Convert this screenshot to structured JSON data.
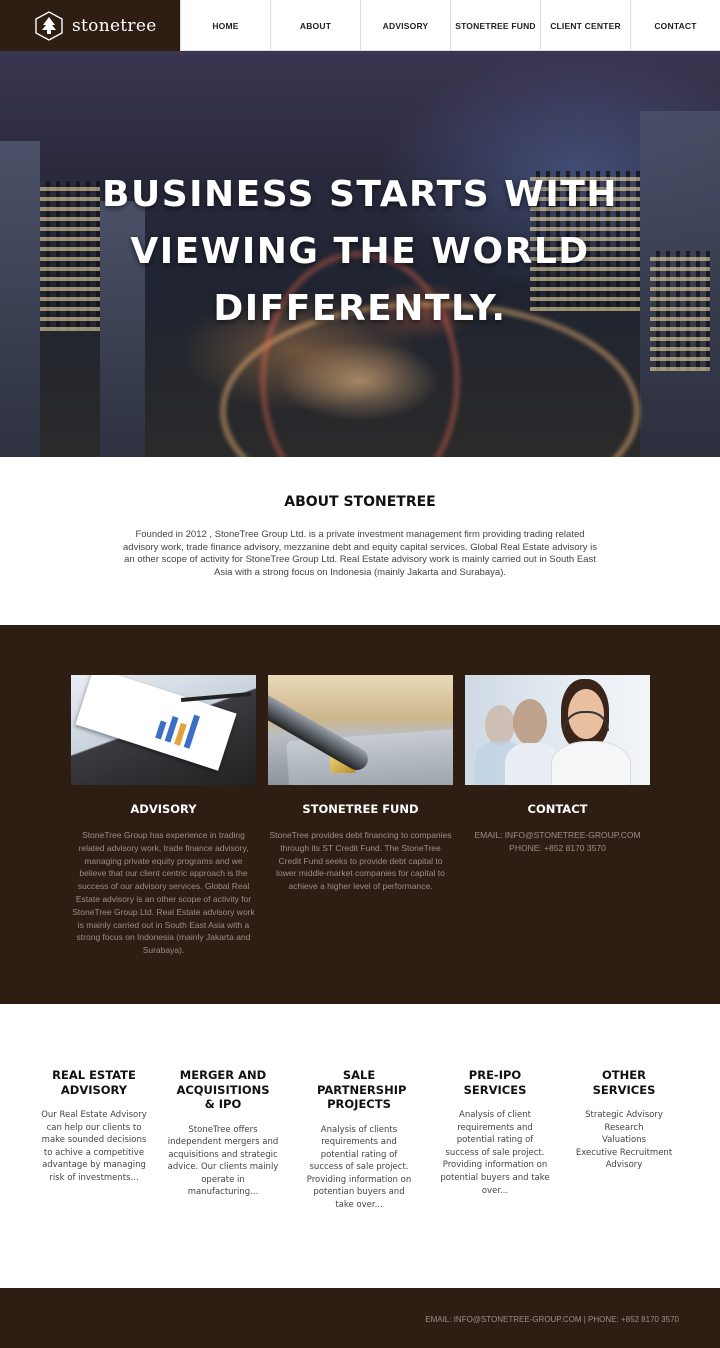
{
  "brand": {
    "name": "stonetree"
  },
  "nav": [
    "HOME",
    "ABOUT",
    "ADVISORY",
    "STONETREE FUND",
    "CLIENT CENTER",
    "CONTACT"
  ],
  "hero": {
    "line1": "BUSINESS STARTS WITH",
    "line2": "VIEWING THE WORLD",
    "line3": "DIFFERENTLY."
  },
  "about": {
    "title": "ABOUT STONETREE",
    "text": "Founded in 2012 , StoneTree Group Ltd. is a private investment management firm providing trading related advisory work, trade finance advisory, mezzanine debt and equity capital services. Global Real Estate advisory is an other scope of activity for StoneTree Group Ltd. Real Estate advisory work is mainly carried out in South East Asia with a strong focus on Indonesia (mainly Jakarta and Surabaya)."
  },
  "cards": [
    {
      "title": "ADVISORY",
      "text": "StoneTree Group has experience in trading related advisory work, trade finance advisory, managing private equity programs and we believe that our client centric approach is the success of our advisory services. Global Real Estate advisory is an other scope of activity for StoneTree Group Ltd. Real Estate advisory work is mainly carried out in South East Asia with a strong focus on Indonesia (mainly Jakarta and Surabaya)."
    },
    {
      "title": "STONETREE FUND",
      "text": "StoneTree provides debt financing to companies through its ST Credit Fund. The StoneTree Credit Fund seeks to provide debt capital to lower middle-market companies for capital to achieve a higher level of performance."
    },
    {
      "title": "CONTACT",
      "email": "EMAIL: INFO@STONETREE-GROUP.COM",
      "phone": "PHONE: +852 8170 3570"
    }
  ],
  "services": [
    {
      "title": "REAL ESTATE ADVISORY",
      "text": "Our Real Estate Advisory can help our clients to make sounded decisions to achive a competitive advantage by managing risk of investments..."
    },
    {
      "title": "MERGER AND ACQUISITIONS & IPO",
      "text": "StoneTree offers independent mergers and acquisitions and strategic advice. Our clients mainly operate in manufacturing..."
    },
    {
      "title": "SALE PARTNERSHIP PROJECTS",
      "text": "Analysis of clients requirements and potential rating of success of sale project. Providing information on potentian buyers and take over..."
    },
    {
      "title": "PRE-IPO SERVICES",
      "text": "Analysis of client requirements and potential rating of success of sale project. Providing information on potential buyers and take over..."
    },
    {
      "title": "OTHER SERVICES",
      "items": [
        "Strategic Advisory",
        "Research",
        "Valuations",
        "Executive Recruitment",
        "Advisory"
      ]
    }
  ],
  "footer": {
    "text": "EMAIL: INFO@STONETREE-GROUP.COM | PHONE: +852 8170 3570"
  },
  "colors": {
    "brand_brown": "#2e1d12",
    "muted_text": "#9a8f88"
  }
}
